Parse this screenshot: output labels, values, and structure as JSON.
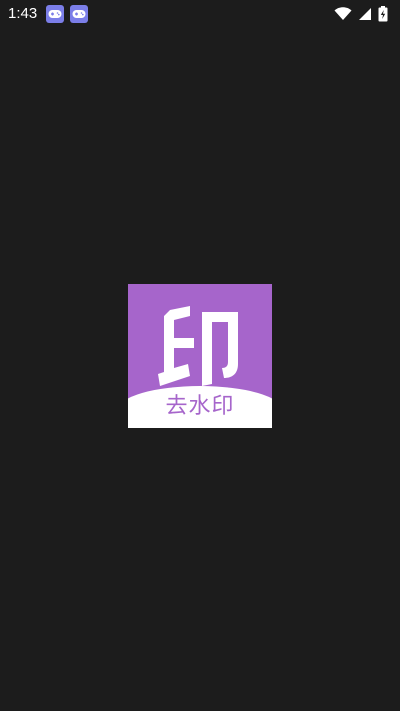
{
  "status_bar": {
    "time": "1:43",
    "notification_icons": [
      "game-controller-icon",
      "game-controller-icon"
    ],
    "system_icons": [
      "wifi-icon",
      "signal-icon",
      "battery-charging-icon"
    ]
  },
  "splash": {
    "logo_caption": "去水印",
    "logo_glyph": "印",
    "colors": {
      "background": "#1c1c1c",
      "logo_purple": "#a665cb",
      "logo_white": "#ffffff"
    }
  }
}
